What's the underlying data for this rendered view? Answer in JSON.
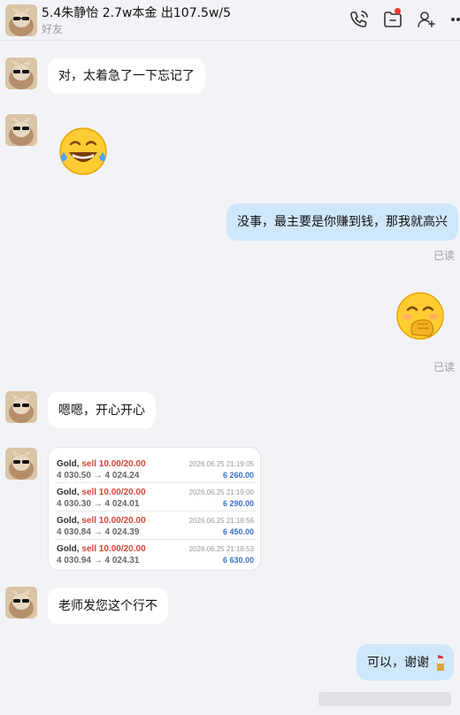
{
  "header": {
    "title": "5.4朱静怡 2.7w本金 出107.5w/5",
    "subtitle": "好友"
  },
  "messages": [
    {
      "from": "friend",
      "text": "对，太着急了一下忘记了"
    },
    {
      "from": "friend",
      "emoji": "laughing-tears-emoji"
    },
    {
      "from": "me",
      "text": "没事，最主要是你赚到钱，那我就高兴",
      "status": "已读"
    },
    {
      "from": "me",
      "emoji": "hand-over-mouth-emoji",
      "status": "已读"
    },
    {
      "from": "friend",
      "text": "嗯嗯，开心开心"
    },
    {
      "from": "friend",
      "type": "trade-screenshot"
    },
    {
      "from": "friend",
      "text": "老师发您这个行不"
    },
    {
      "from": "me",
      "text": "可以，谢谢",
      "trailing_icon": "lipstick-emoji"
    }
  ],
  "trades": [
    {
      "symbol": "Gold,",
      "side": "sell 10.00/20.00",
      "prices": "4 030.50 → 4 024.24",
      "time": "2026.06.25 21:19:05",
      "profit": "6 260.00"
    },
    {
      "symbol": "Gold,",
      "side": "sell 10.00/20.00",
      "prices": "4 030.30 → 4 024.01",
      "time": "2026.06.25 21:19:00",
      "profit": "6 290.00"
    },
    {
      "symbol": "Gold,",
      "side": "sell 10.00/20.00",
      "prices": "4 030.84 → 4 024.39",
      "time": "2026.06.25 21:18:56",
      "profit": "6 450.00"
    },
    {
      "symbol": "Gold,",
      "side": "sell 10.00/20.00",
      "prices": "4 030.94 → 4 024.31",
      "time": "2026.06.25 21:18:53",
      "profit": "6 630.00"
    }
  ],
  "icons": {
    "call": "phone-call-icon",
    "files": "folder-icon",
    "add_friend": "add-person-icon",
    "more": "more-icon"
  },
  "colors": {
    "my_bubble": "#cfe7fb",
    "friend_bubble": "#ffffff",
    "notification_dot": "#f03c2e",
    "sell_text": "#d2453a",
    "profit_text": "#3a6fc9"
  }
}
